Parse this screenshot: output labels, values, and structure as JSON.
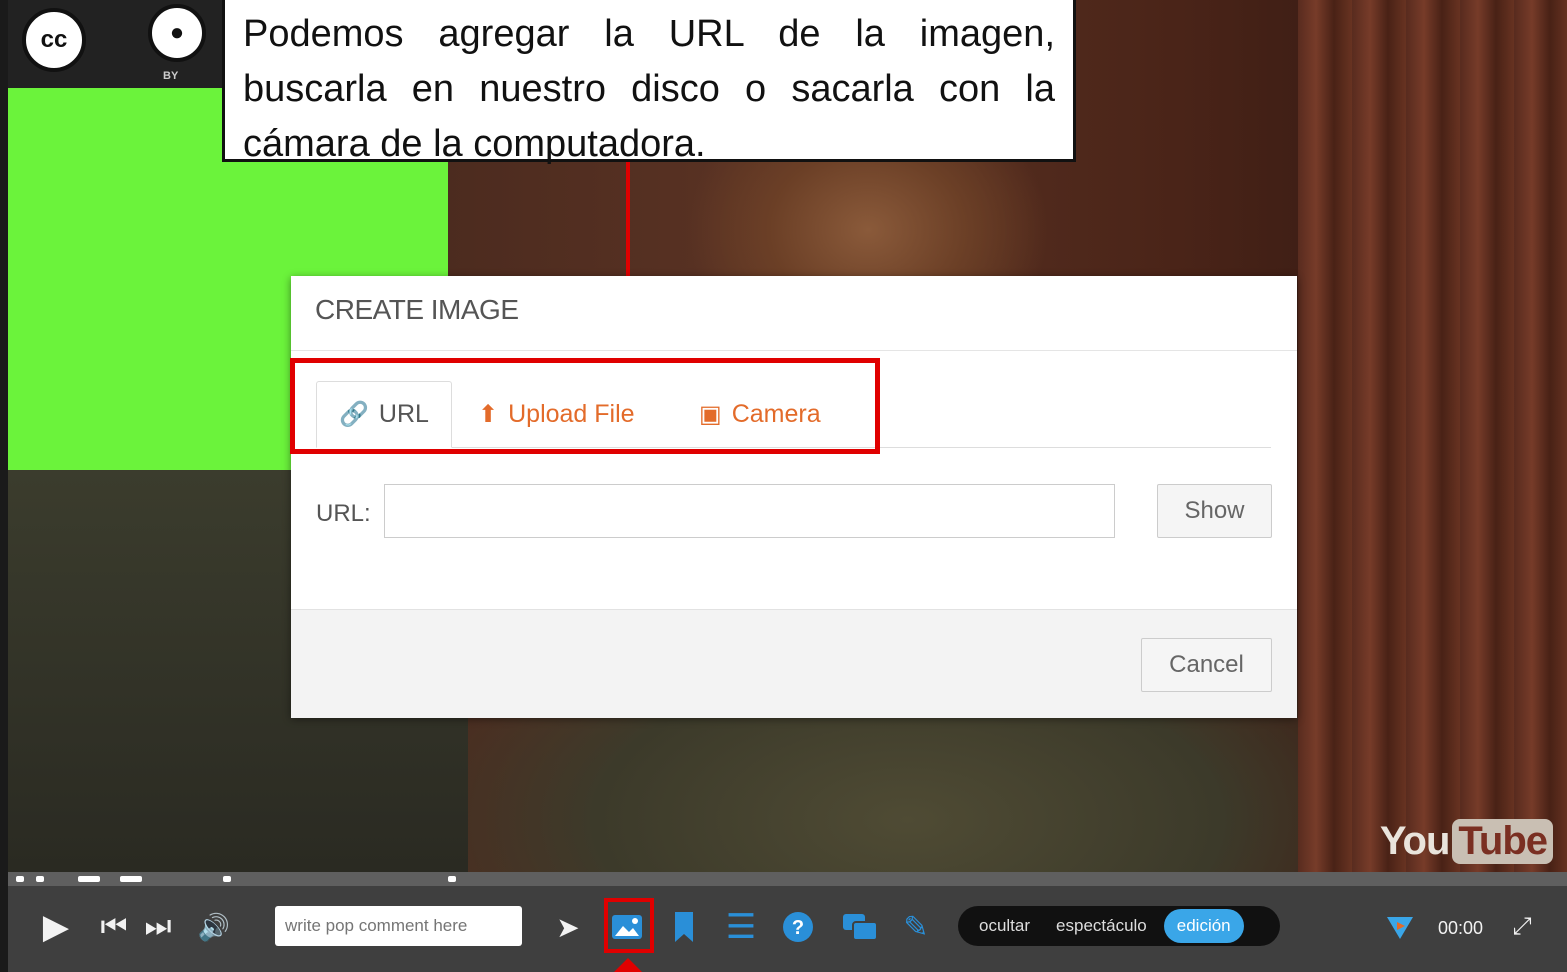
{
  "callout": {
    "text": "Podemos agregar la URL de la imagen, buscarla en nuestro disco o sacarla con la cámara de la computadora."
  },
  "video": {
    "youtube_you": "You",
    "youtube_tube": "Tube",
    "cc_by": "BY"
  },
  "dialog": {
    "title": "CREATE IMAGE",
    "tabs": [
      {
        "label": "URL",
        "icon": "link-icon"
      },
      {
        "label": "Upload File",
        "icon": "upload-icon"
      },
      {
        "label": "Camera",
        "icon": "camera-icon"
      }
    ],
    "url_label": "URL:",
    "url_value": "",
    "show_label": "Show",
    "cancel_label": "Cancel"
  },
  "player": {
    "comment_placeholder": "write pop comment here",
    "modes": [
      "ocultar",
      "espectáculo",
      "edición"
    ],
    "active_mode": "edición",
    "time": "00:00"
  },
  "colors": {
    "highlight": "#e00000",
    "tab_accent": "#e36b2a",
    "mode_active": "#3aa6e8"
  }
}
